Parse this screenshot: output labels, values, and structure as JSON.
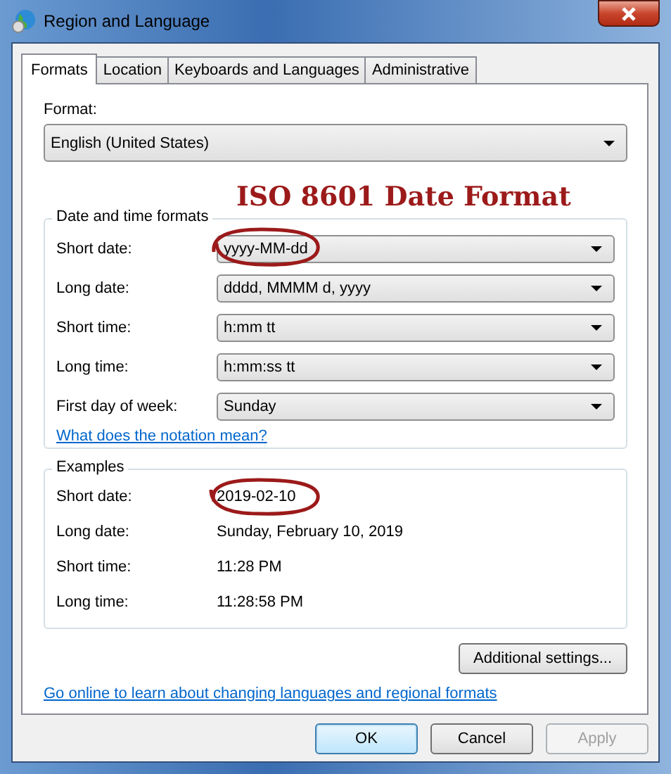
{
  "window": {
    "title": "Region and Language"
  },
  "tabs": [
    {
      "label": "Formats",
      "selected": true
    },
    {
      "label": "Location",
      "selected": false
    },
    {
      "label": "Keyboards and Languages",
      "selected": false
    },
    {
      "label": "Administrative",
      "selected": false
    }
  ],
  "format": {
    "label": "Format:",
    "value": "English (United States)"
  },
  "annotation": "ISO 8601 Date Format",
  "date_time_formats": {
    "title": "Date and time formats",
    "rows": [
      {
        "label": "Short date:",
        "value": "yyyy-MM-dd",
        "circled": true
      },
      {
        "label": "Long date:",
        "value": "dddd, MMMM d, yyyy",
        "circled": false
      },
      {
        "label": "Short time:",
        "value": "h:mm tt",
        "circled": false
      },
      {
        "label": "Long time:",
        "value": "h:mm:ss tt",
        "circled": false
      },
      {
        "label": "First day of week:",
        "value": "Sunday",
        "circled": false
      }
    ],
    "link": "What does the notation mean?"
  },
  "examples": {
    "title": "Examples",
    "rows": [
      {
        "label": "Short date:",
        "value": "2019-02-10",
        "circled": true
      },
      {
        "label": "Long date:",
        "value": "Sunday, February 10, 2019",
        "circled": false
      },
      {
        "label": "Short time:",
        "value": "11:28 PM",
        "circled": false
      },
      {
        "label": "Long time:",
        "value": "11:28:58 PM",
        "circled": false
      }
    ]
  },
  "additional_button": "Additional settings...",
  "online_link": "Go online to learn about changing languages and regional formats",
  "buttons": [
    {
      "label": "OK",
      "default": true,
      "disabled": false
    },
    {
      "label": "Cancel",
      "default": false,
      "disabled": false
    },
    {
      "label": "Apply",
      "default": false,
      "disabled": true
    }
  ]
}
